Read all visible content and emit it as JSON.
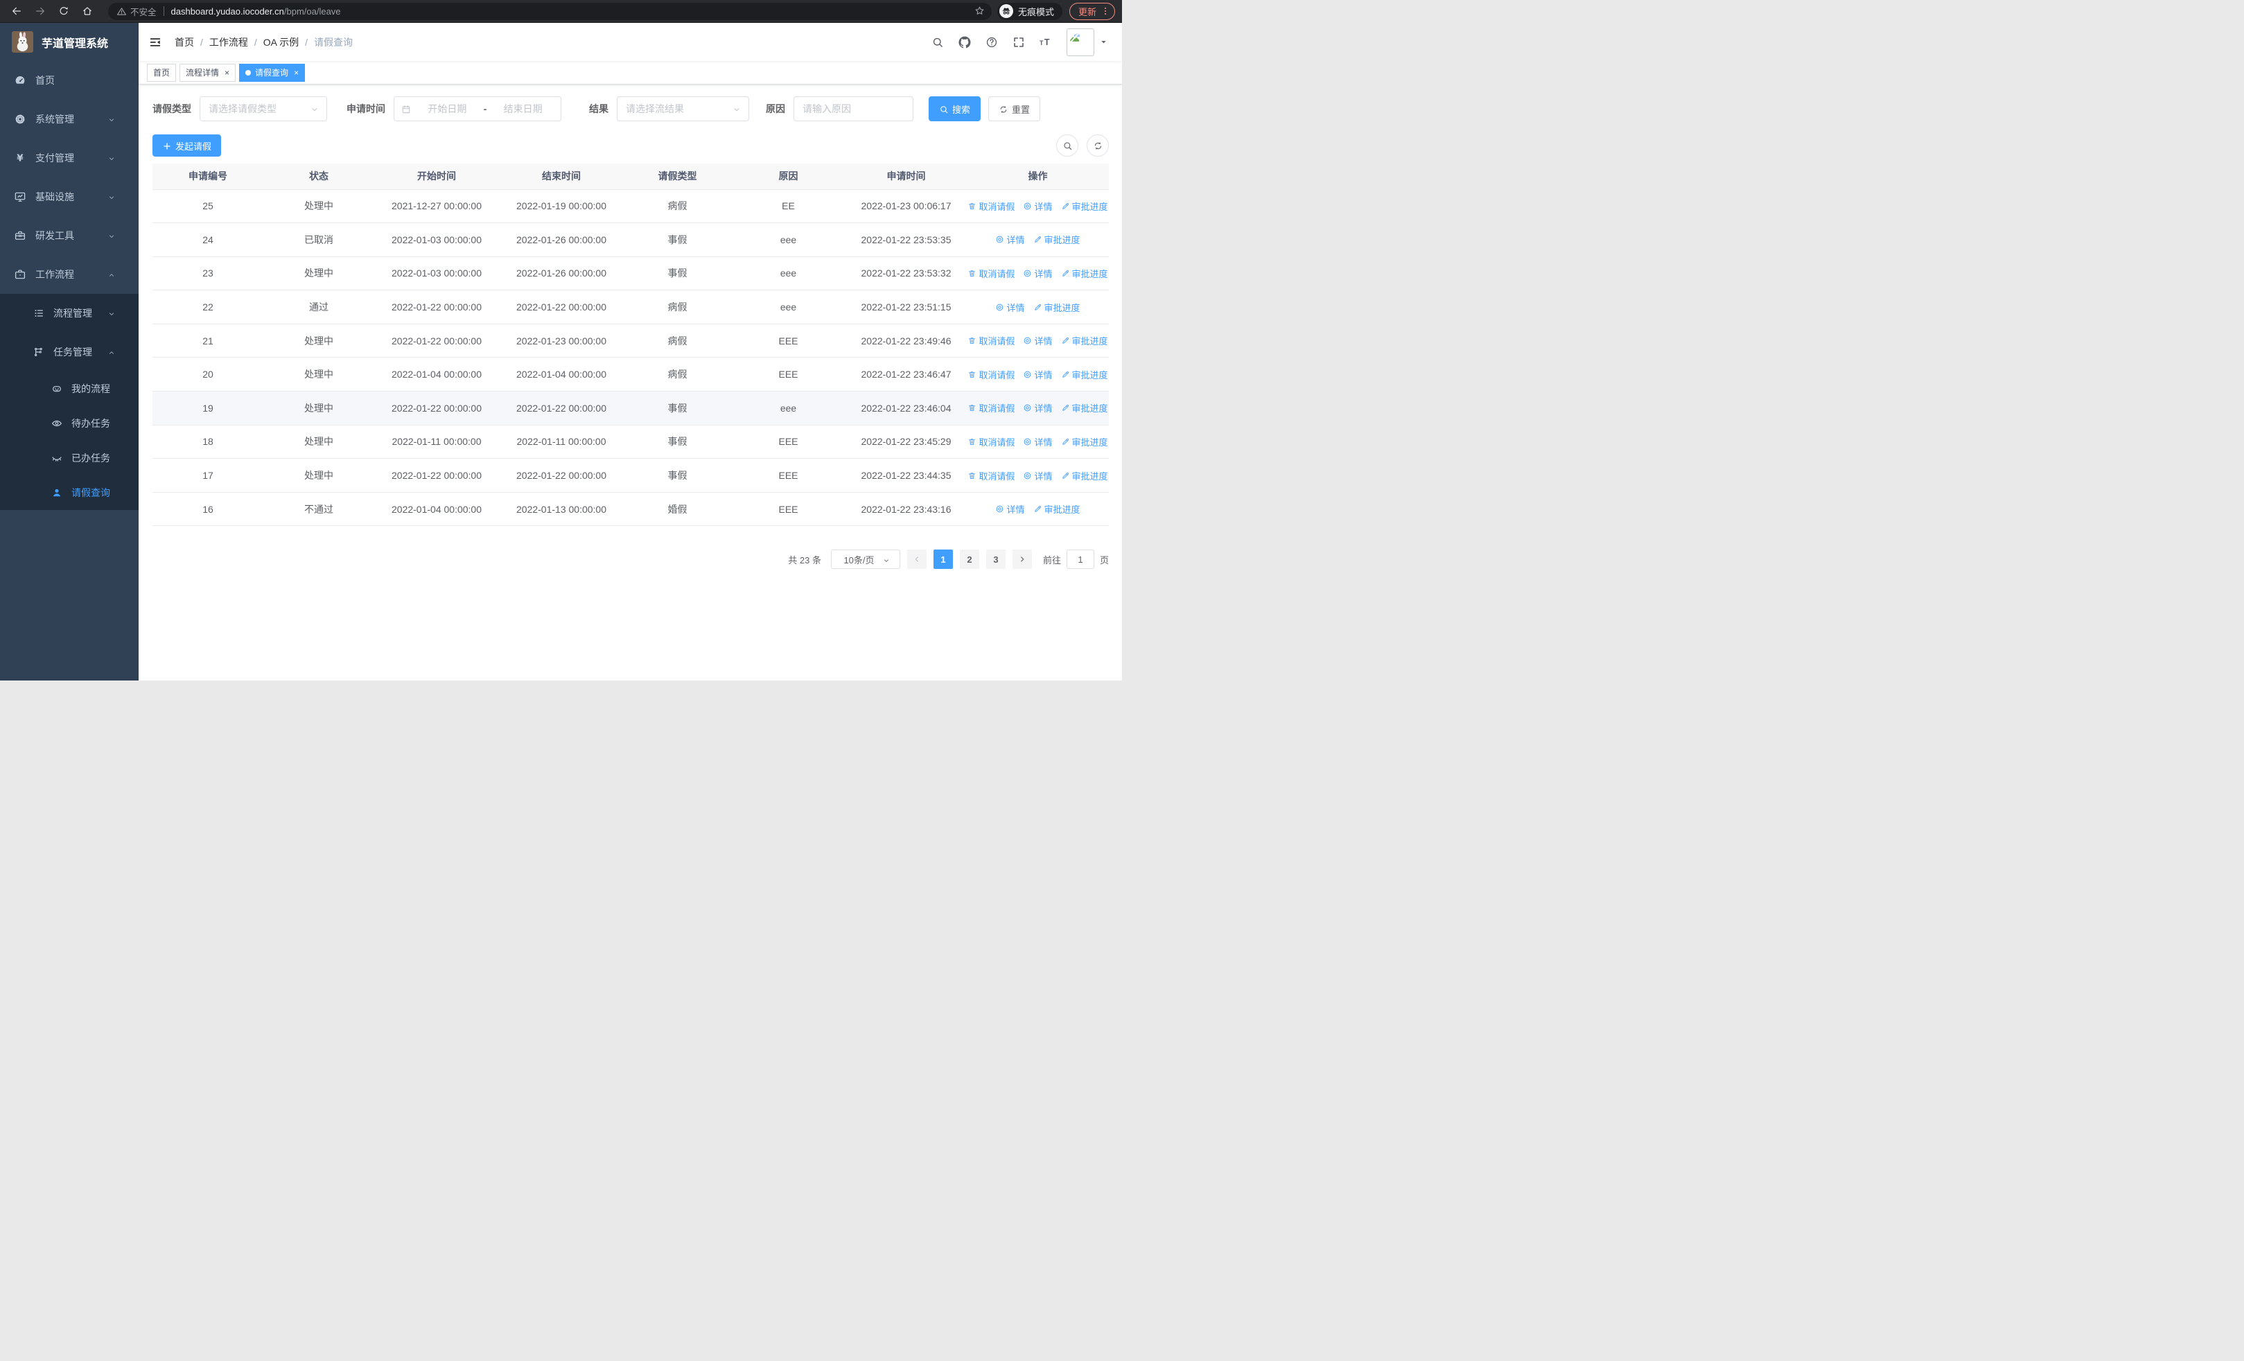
{
  "browser": {
    "security_label": "不安全",
    "url_host": "dashboard.yudao.iocoder.cn",
    "url_path": "/bpm/oa/leave",
    "incognito_label": "无痕模式",
    "update_label": "更新",
    "nav_icons": [
      "back-icon",
      "forward-icon",
      "reload-icon",
      "home-icon"
    ]
  },
  "colors": {
    "primary": "#409EFF",
    "sidebar_bg": "#304156",
    "submenu_bg": "#1f2d3d",
    "sidebar_text": "#bfcbd9",
    "update_accent": "#f28b82",
    "table_header_bg": "#f8f8f9",
    "highlight_row_bg": "#f5f7fa"
  },
  "sidebar": {
    "title": "芋道管理系统",
    "logo_icon": "rabbit-logo",
    "items": [
      {
        "label": "首页",
        "icon": "dashboard-icon",
        "level": 1
      },
      {
        "label": "系统管理",
        "icon": "gear-icon",
        "level": 1,
        "chevron": "down"
      },
      {
        "label": "支付管理",
        "icon": "yen-icon",
        "level": 1,
        "chevron": "down"
      },
      {
        "label": "基础设施",
        "icon": "monitor-icon",
        "level": 1,
        "chevron": "down"
      },
      {
        "label": "研发工具",
        "icon": "toolbox-icon",
        "level": 1,
        "chevron": "down"
      },
      {
        "label": "工作流程",
        "icon": "briefcase-icon",
        "level": 1,
        "chevron": "up"
      },
      {
        "label": "流程管理",
        "icon": "flow-list-icon",
        "level": 2,
        "chevron": "down",
        "sub": true
      },
      {
        "label": "任务管理",
        "icon": "branch-icon",
        "level": 2,
        "chevron": "up",
        "sub": true
      },
      {
        "label": "我的流程",
        "icon": "robot-icon",
        "level": 3,
        "sub": true
      },
      {
        "label": "待办任务",
        "icon": "eye-open-icon",
        "level": 3,
        "sub": true
      },
      {
        "label": "已办任务",
        "icon": "eye-closed-icon",
        "level": 3,
        "sub": true
      },
      {
        "label": "请假查询",
        "icon": "user-icon",
        "level": 3,
        "sub": true,
        "active": true
      }
    ]
  },
  "navbar": {
    "breadcrumb": [
      {
        "label": "首页"
      },
      {
        "label": "工作流程"
      },
      {
        "label": "OA 示例"
      },
      {
        "label": "请假查询",
        "muted": true
      }
    ],
    "separator": "/",
    "right_icons": [
      "search-icon",
      "github-icon",
      "question-icon",
      "fullscreen-icon",
      "fontsize-icon"
    ]
  },
  "tabs": [
    {
      "label": "首页",
      "closable": false,
      "active": false
    },
    {
      "label": "流程详情",
      "closable": true,
      "active": false
    },
    {
      "label": "请假查询",
      "closable": true,
      "active": true
    }
  ],
  "filters": {
    "leave_type": {
      "label": "请假类型",
      "placeholder": "请选择请假类型"
    },
    "apply_time": {
      "label": "申请时间",
      "start_placeholder": "开始日期",
      "separator": "-",
      "end_placeholder": "结束日期"
    },
    "result": {
      "label": "结果",
      "placeholder": "请选择流结果"
    },
    "reason": {
      "label": "原因",
      "placeholder": "请输入原因"
    },
    "search_label": "搜索",
    "reset_label": "重置"
  },
  "toolbar": {
    "create_label": "发起请假"
  },
  "table": {
    "columns": [
      "申请编号",
      "状态",
      "开始时间",
      "结束时间",
      "请假类型",
      "原因",
      "申请时间",
      "操作"
    ],
    "action_defs": {
      "cancel": {
        "label": "取消请假",
        "icon": "trash-icon"
      },
      "detail": {
        "label": "详情",
        "icon": "view-icon"
      },
      "progress": {
        "label": "审批进度",
        "icon": "edit-icon"
      }
    },
    "rows": [
      {
        "id": "25",
        "status": "处理中",
        "start_time": "2021-12-27 00:00:00",
        "end_time": "2022-01-19 00:00:00",
        "leave_type": "病假",
        "reason": "EE",
        "apply_time": "2022-01-23 00:06:17",
        "actions": [
          "cancel",
          "detail",
          "progress"
        ]
      },
      {
        "id": "24",
        "status": "已取消",
        "start_time": "2022-01-03 00:00:00",
        "end_time": "2022-01-26 00:00:00",
        "leave_type": "事假",
        "reason": "eee",
        "apply_time": "2022-01-22 23:53:35",
        "actions": [
          "detail",
          "progress"
        ]
      },
      {
        "id": "23",
        "status": "处理中",
        "start_time": "2022-01-03 00:00:00",
        "end_time": "2022-01-26 00:00:00",
        "leave_type": "事假",
        "reason": "eee",
        "apply_time": "2022-01-22 23:53:32",
        "actions": [
          "cancel",
          "detail",
          "progress"
        ]
      },
      {
        "id": "22",
        "status": "通过",
        "start_time": "2022-01-22 00:00:00",
        "end_time": "2022-01-22 00:00:00",
        "leave_type": "病假",
        "reason": "eee",
        "apply_time": "2022-01-22 23:51:15",
        "actions": [
          "detail",
          "progress"
        ]
      },
      {
        "id": "21",
        "status": "处理中",
        "start_time": "2022-01-22 00:00:00",
        "end_time": "2022-01-23 00:00:00",
        "leave_type": "病假",
        "reason": "EEE",
        "apply_time": "2022-01-22 23:49:46",
        "actions": [
          "cancel",
          "detail",
          "progress"
        ]
      },
      {
        "id": "20",
        "status": "处理中",
        "start_time": "2022-01-04 00:00:00",
        "end_time": "2022-01-04 00:00:00",
        "leave_type": "病假",
        "reason": "EEE",
        "apply_time": "2022-01-22 23:46:47",
        "actions": [
          "cancel",
          "detail",
          "progress"
        ]
      },
      {
        "id": "19",
        "status": "处理中",
        "start_time": "2022-01-22 00:00:00",
        "end_time": "2022-01-22 00:00:00",
        "leave_type": "事假",
        "reason": "eee",
        "apply_time": "2022-01-22 23:46:04",
        "actions": [
          "cancel",
          "detail",
          "progress"
        ],
        "highlighted": true
      },
      {
        "id": "18",
        "status": "处理中",
        "start_time": "2022-01-11 00:00:00",
        "end_time": "2022-01-11 00:00:00",
        "leave_type": "事假",
        "reason": "EEE",
        "apply_time": "2022-01-22 23:45:29",
        "actions": [
          "cancel",
          "detail",
          "progress"
        ]
      },
      {
        "id": "17",
        "status": "处理中",
        "start_time": "2022-01-22 00:00:00",
        "end_time": "2022-01-22 00:00:00",
        "leave_type": "事假",
        "reason": "EEE",
        "apply_time": "2022-01-22 23:44:35",
        "actions": [
          "cancel",
          "detail",
          "progress"
        ]
      },
      {
        "id": "16",
        "status": "不通过",
        "start_time": "2022-01-04 00:00:00",
        "end_time": "2022-01-13 00:00:00",
        "leave_type": "婚假",
        "reason": "EEE",
        "apply_time": "2022-01-22 23:43:16",
        "actions": [
          "detail",
          "progress"
        ]
      }
    ]
  },
  "pagination": {
    "total_label": "共 23 条",
    "page_size_label": "10条/页",
    "pages": [
      "1",
      "2",
      "3"
    ],
    "active_page": "1",
    "goto_label": "前往",
    "goto_value": "1",
    "page_unit": "页"
  }
}
